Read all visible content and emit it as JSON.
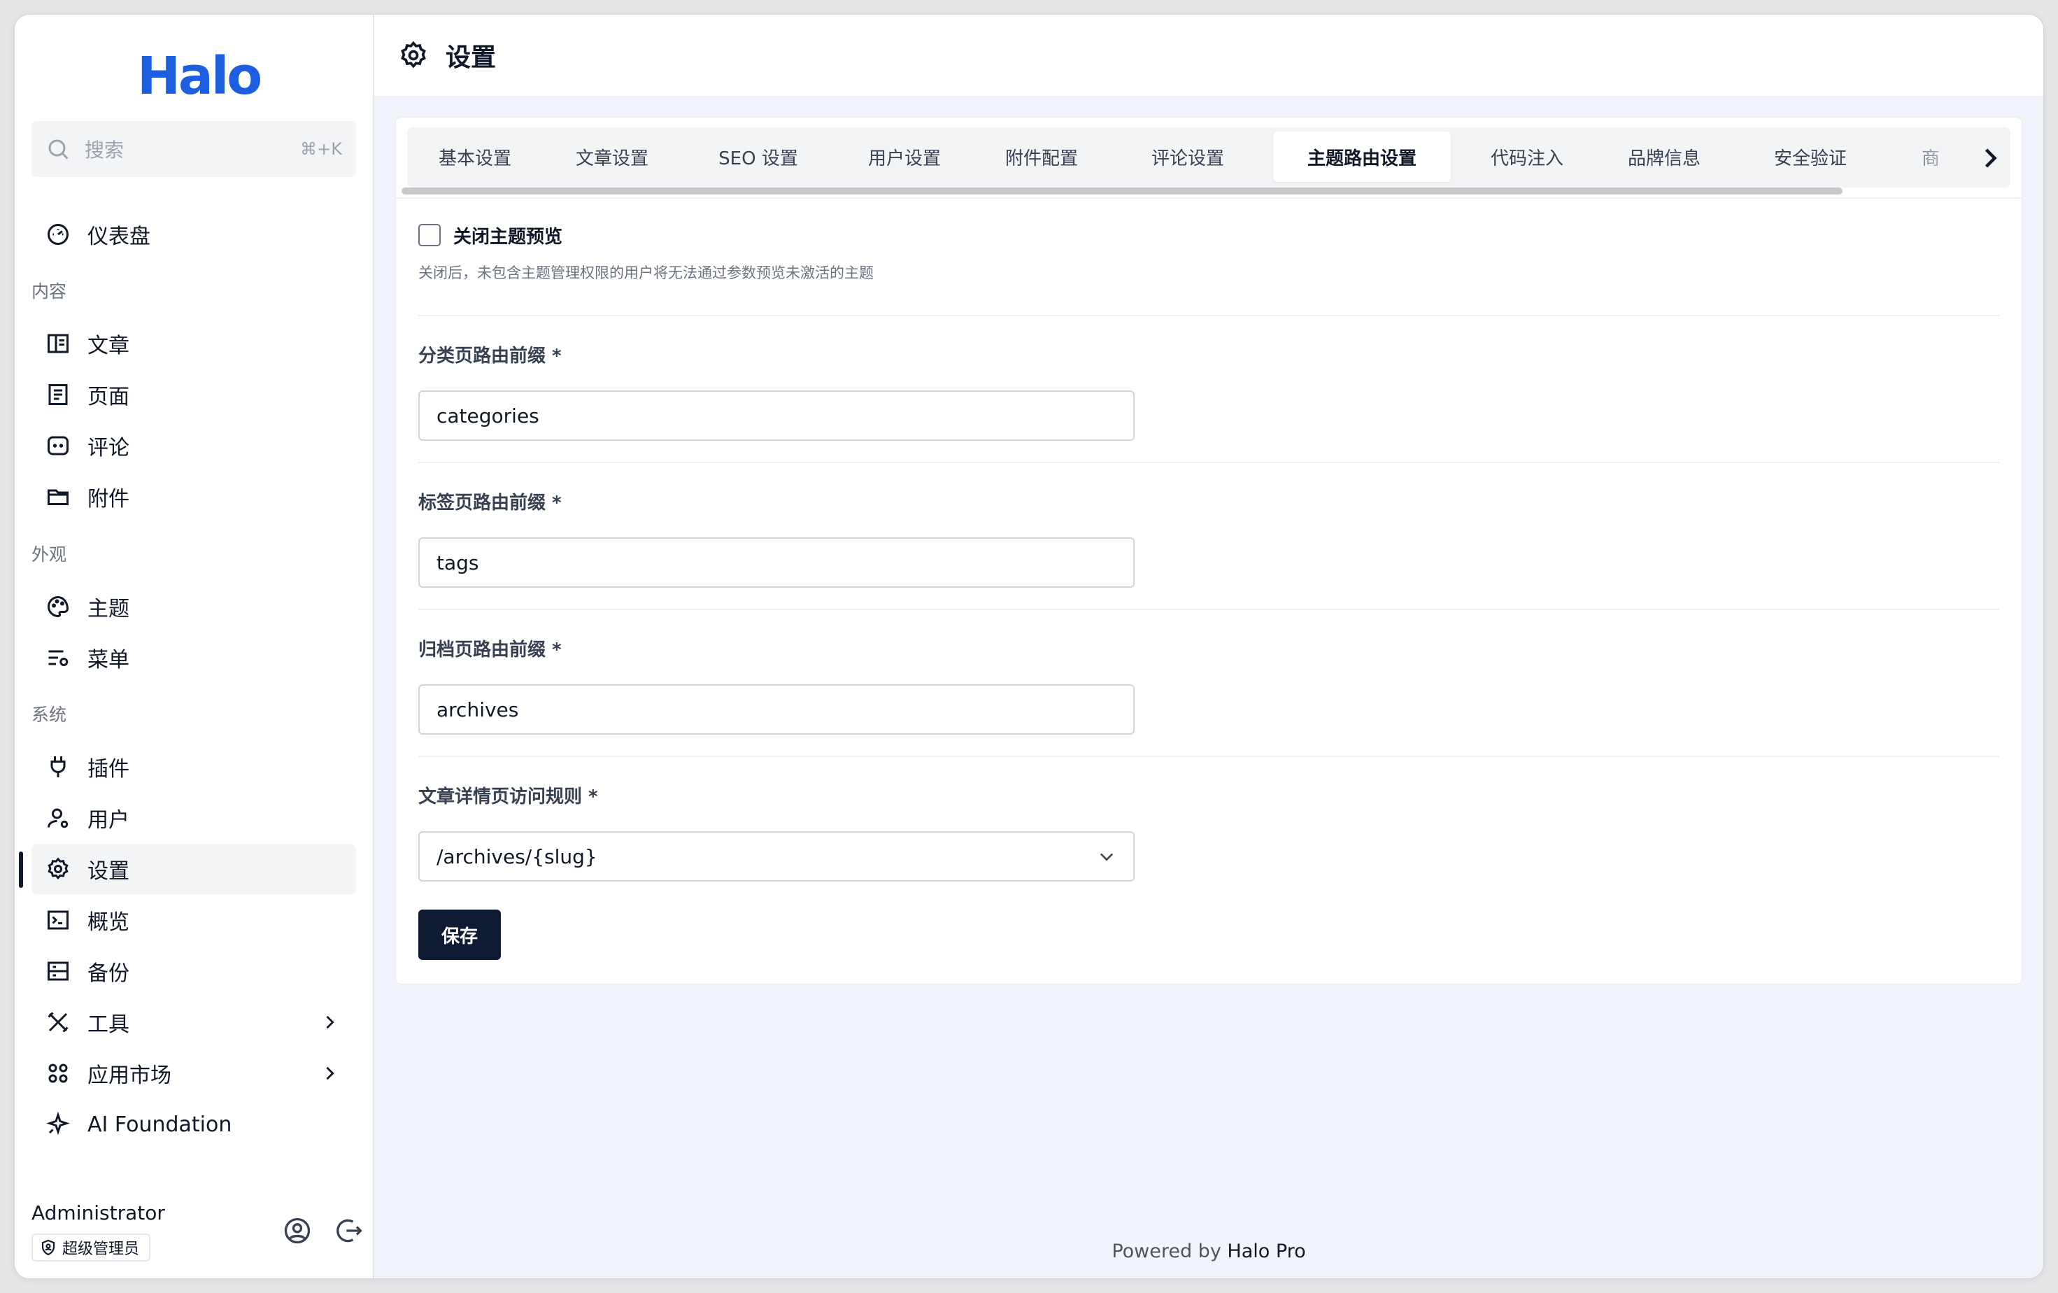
{
  "app": {
    "logo_text": "Halo",
    "brand_color": "#1d5ee0"
  },
  "search": {
    "placeholder": "搜索",
    "shortcut": "⌘+K"
  },
  "sidebar": {
    "items_top": [
      {
        "label": "仪表盘",
        "icon": "dashboard-icon"
      }
    ],
    "section_content": "内容",
    "items_content": [
      {
        "label": "文章",
        "icon": "posts-icon"
      },
      {
        "label": "页面",
        "icon": "pages-icon"
      },
      {
        "label": "评论",
        "icon": "comments-icon"
      },
      {
        "label": "附件",
        "icon": "attachments-icon"
      }
    ],
    "section_appearance": "外观",
    "items_appearance": [
      {
        "label": "主题",
        "icon": "palette-icon"
      },
      {
        "label": "菜单",
        "icon": "menu-icon"
      }
    ],
    "section_system": "系统",
    "items_system": [
      {
        "label": "插件",
        "icon": "plug-icon"
      },
      {
        "label": "用户",
        "icon": "user-icon"
      },
      {
        "label": "设置",
        "icon": "gear-icon",
        "active": true
      },
      {
        "label": "概览",
        "icon": "terminal-icon"
      },
      {
        "label": "备份",
        "icon": "backup-icon"
      },
      {
        "label": "工具",
        "icon": "tools-icon",
        "has_children": true
      },
      {
        "label": "应用市场",
        "icon": "apps-icon",
        "has_children": true
      },
      {
        "label": "AI Foundation",
        "icon": "sparkle-icon"
      }
    ]
  },
  "user": {
    "name": "Administrator",
    "role": "超级管理员"
  },
  "header": {
    "title": "设置"
  },
  "tabs": [
    {
      "label": "基本设置"
    },
    {
      "label": "文章设置"
    },
    {
      "label": "SEO 设置"
    },
    {
      "label": "用户设置"
    },
    {
      "label": "附件配置"
    },
    {
      "label": "评论设置"
    },
    {
      "label": "主题路由设置",
      "active": true
    },
    {
      "label": "代码注入"
    },
    {
      "label": "品牌信息"
    },
    {
      "label": "安全验证"
    },
    {
      "label": "商"
    }
  ],
  "form": {
    "disable_preview": {
      "label": "关闭主题预览",
      "help": "关闭后，未包含主题管理权限的用户将无法通过参数预览未激活的主题",
      "checked": false
    },
    "category_prefix": {
      "label": "分类页路由前缀 *",
      "value": "categories"
    },
    "tag_prefix": {
      "label": "标签页路由前缀 *",
      "value": "tags"
    },
    "archive_prefix": {
      "label": "归档页路由前缀 *",
      "value": "archives"
    },
    "post_rule": {
      "label": "文章详情页访问规则 *",
      "value": "/archives/{slug}"
    },
    "save_label": "保存"
  },
  "footer": {
    "prefix": "Powered by ",
    "brand": "Halo Pro"
  }
}
